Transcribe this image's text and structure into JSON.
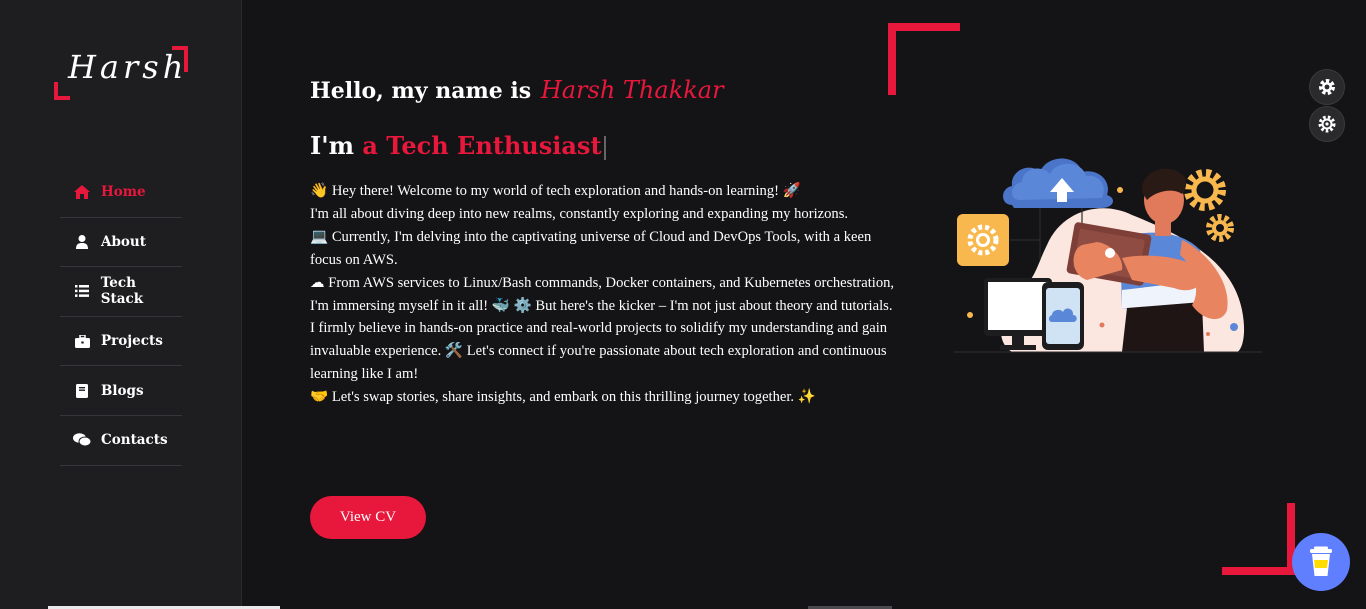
{
  "logo": {
    "text": "Harsh"
  },
  "nav": {
    "items": [
      {
        "label": "Home",
        "icon": "home-icon",
        "active": true
      },
      {
        "label": "About",
        "icon": "user-icon"
      },
      {
        "label": "Tech Stack",
        "icon": "list-icon"
      },
      {
        "label": "Projects",
        "icon": "briefcase-icon"
      },
      {
        "label": "Blogs",
        "icon": "book-icon"
      },
      {
        "label": "Contacts",
        "icon": "comments-icon"
      }
    ]
  },
  "hero": {
    "greeting": "Hello, my name is",
    "name": "Harsh Thakkar",
    "role_prefix": "I'm",
    "role_highlight": "a Tech Enthusiast",
    "bio": [
      "👋 Hey there! Welcome to my world of tech exploration and hands-on learning! 🚀",
      "I'm all about diving deep into new realms, constantly exploring and expanding my horizons.",
      "💻 Currently, I'm delving into the captivating universe of Cloud and DevOps Tools, with a keen focus on AWS.",
      "☁ From AWS services to Linux/Bash commands, Docker containers, and Kubernetes orchestration, I'm immersing myself in it all! 🐳 ⚙️ But here's the kicker – I'm not just about theory and tutorials.",
      "I firmly believe in hands-on practice and real-world projects to solidify my understanding and gain invaluable experience. 🛠️ Let's connect if you're passionate about tech exploration and continuous learning like I am!",
      "🤝 Let's swap stories, share insights, and embark on this thrilling journey together. ✨"
    ],
    "cv_button": "View CV"
  },
  "colors": {
    "accent": "#e8173c",
    "background": "#141315",
    "sidebar": "#1e1e20",
    "coffee": "#5f7fff"
  },
  "controls": {
    "settings_icon_1": "gear-icon",
    "settings_icon_2": "sun-gear-icon",
    "coffee_icon": "coffee-cup-icon"
  }
}
